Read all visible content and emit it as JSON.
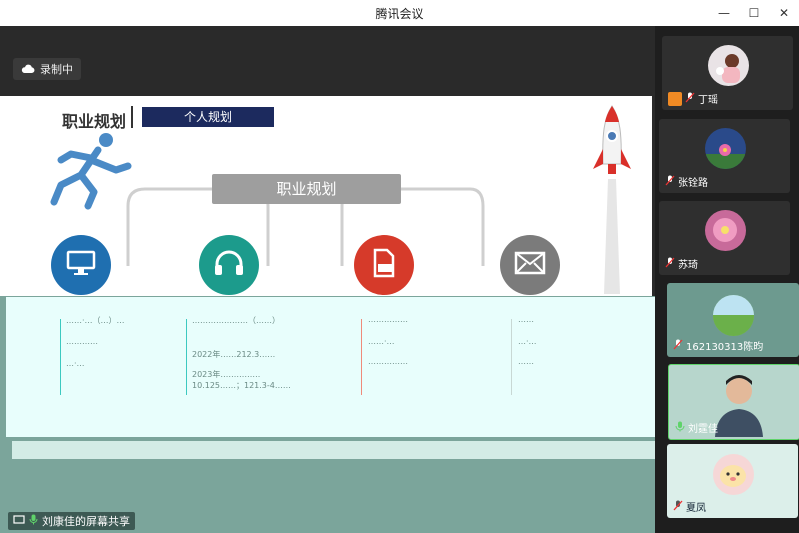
{
  "window": {
    "title": "腾讯会议"
  },
  "recording": {
    "label": "录制中"
  },
  "slide": {
    "title": "职业规划",
    "tag": "个人规划",
    "center_label": "职业规划",
    "nodes": [
      {
        "icon": "monitor-icon",
        "color": "#1f6fb0"
      },
      {
        "icon": "headphones-icon",
        "color": "#1c9b8c"
      },
      {
        "icon": "document-icon",
        "color": "#d63a2a"
      },
      {
        "icon": "envelope-icon",
        "color": "#7b7b7b"
      }
    ]
  },
  "shared_text": {
    "col1": [
      "……·…（…）…",
      "…………",
      "…·…"
    ],
    "col2": [
      "…………………（……）",
      "2022年……212.3……",
      "2023年……………",
      "10.125……；121.3-4……"
    ],
    "col3": [
      "……………",
      "……·…",
      "……………"
    ],
    "col4": [
      "……",
      "…·…",
      "……"
    ]
  },
  "share": {
    "label": "刘康佳的屏幕共享"
  },
  "participants": [
    {
      "name": "丁瑶",
      "avatar_color": "#e9e3e6"
    },
    {
      "name": "张铨路",
      "avatar_color": "#2a4a8a"
    },
    {
      "name": "苏琦",
      "avatar_color": "#c86a9a"
    },
    {
      "name": "162130313陈昀",
      "avatar_color": "#88c26a"
    },
    {
      "name": "刘霆佳",
      "avatar_color": "#a9c9bf"
    },
    {
      "name": "夏凤",
      "avatar_color": "#f6d7d7"
    }
  ]
}
